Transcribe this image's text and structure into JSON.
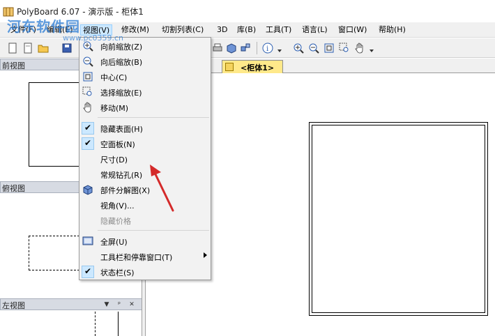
{
  "window": {
    "title": "PolyBoard 6.07 - 演示版 - 柜体1"
  },
  "watermark": {
    "text": "河东软件园",
    "url": "www.pc0359.cn"
  },
  "menubar": {
    "items": [
      {
        "label": "文件(F)"
      },
      {
        "label": "编辑(E)"
      },
      {
        "label": "视图(V)"
      },
      {
        "label": "修改(M)"
      },
      {
        "label": "切割列表(C)"
      },
      {
        "label": "3D"
      },
      {
        "label": "库(B)"
      },
      {
        "label": "工具(T)"
      },
      {
        "label": "语言(L)"
      },
      {
        "label": "窗口(W)"
      },
      {
        "label": "帮助(H)"
      }
    ]
  },
  "panes": {
    "front": {
      "title": "前视图"
    },
    "top": {
      "title": "俯视图"
    },
    "left": {
      "title": "左视图",
      "buttons": [
        "▼",
        "ᵖ",
        "✕"
      ]
    }
  },
  "document": {
    "tab_label": "<柜体1>"
  },
  "view_menu": {
    "items": [
      {
        "label": "向前缩放(Z)",
        "icon": "zoom-in-icon"
      },
      {
        "label": "向后缩放(B)",
        "icon": "zoom-out-icon"
      },
      {
        "label": "中心(C)",
        "icon": "center-icon"
      },
      {
        "label": "选择缩放(E)",
        "icon": "zoom-select-icon"
      },
      {
        "label": "移动(M)",
        "icon": "pan-hand-icon"
      },
      {
        "label": "隐藏表面(H)",
        "checked": true
      },
      {
        "label": "空面板(N)",
        "checked": true
      },
      {
        "label": "尺寸(D)"
      },
      {
        "label": "常规钻孔(R)"
      },
      {
        "label": "部件分解图(X)",
        "icon": "exploded-view-icon"
      },
      {
        "label": "视角(V)..."
      },
      {
        "label": "隐藏价格",
        "disabled": true
      },
      {
        "label": "全屏(U)",
        "icon": "fullscreen-icon"
      },
      {
        "label": "工具栏和停靠窗口(T)",
        "submenu": true
      },
      {
        "label": "状态栏(S)",
        "checked": true
      }
    ]
  },
  "colors": {
    "accent": "#cce8ff",
    "annotation_arrow": "#d42a2a",
    "tab_active": "#ffe98a"
  }
}
